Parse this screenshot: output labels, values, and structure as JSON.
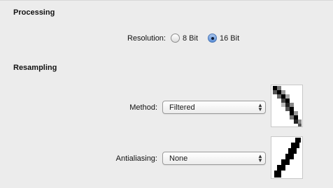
{
  "processing": {
    "title": "Processing",
    "resolution_label": "Resolution:",
    "options": [
      {
        "label": "8 Bit",
        "selected": false
      },
      {
        "label": "16 Bit",
        "selected": true
      }
    ]
  },
  "resampling": {
    "title": "Resampling",
    "method_label": "Method:",
    "method_value": "Filtered",
    "antialiasing_label": "Antialiasing:",
    "antialiasing_value": "None"
  },
  "icons": {
    "select_arrows": "up-down-chevron-icon",
    "method_preview": "filtered-line-preview-icon",
    "antialiasing_preview": "aliased-line-preview-icon"
  },
  "colors": {
    "background": "#ececec",
    "radio_selected": "#5b8fd6"
  }
}
